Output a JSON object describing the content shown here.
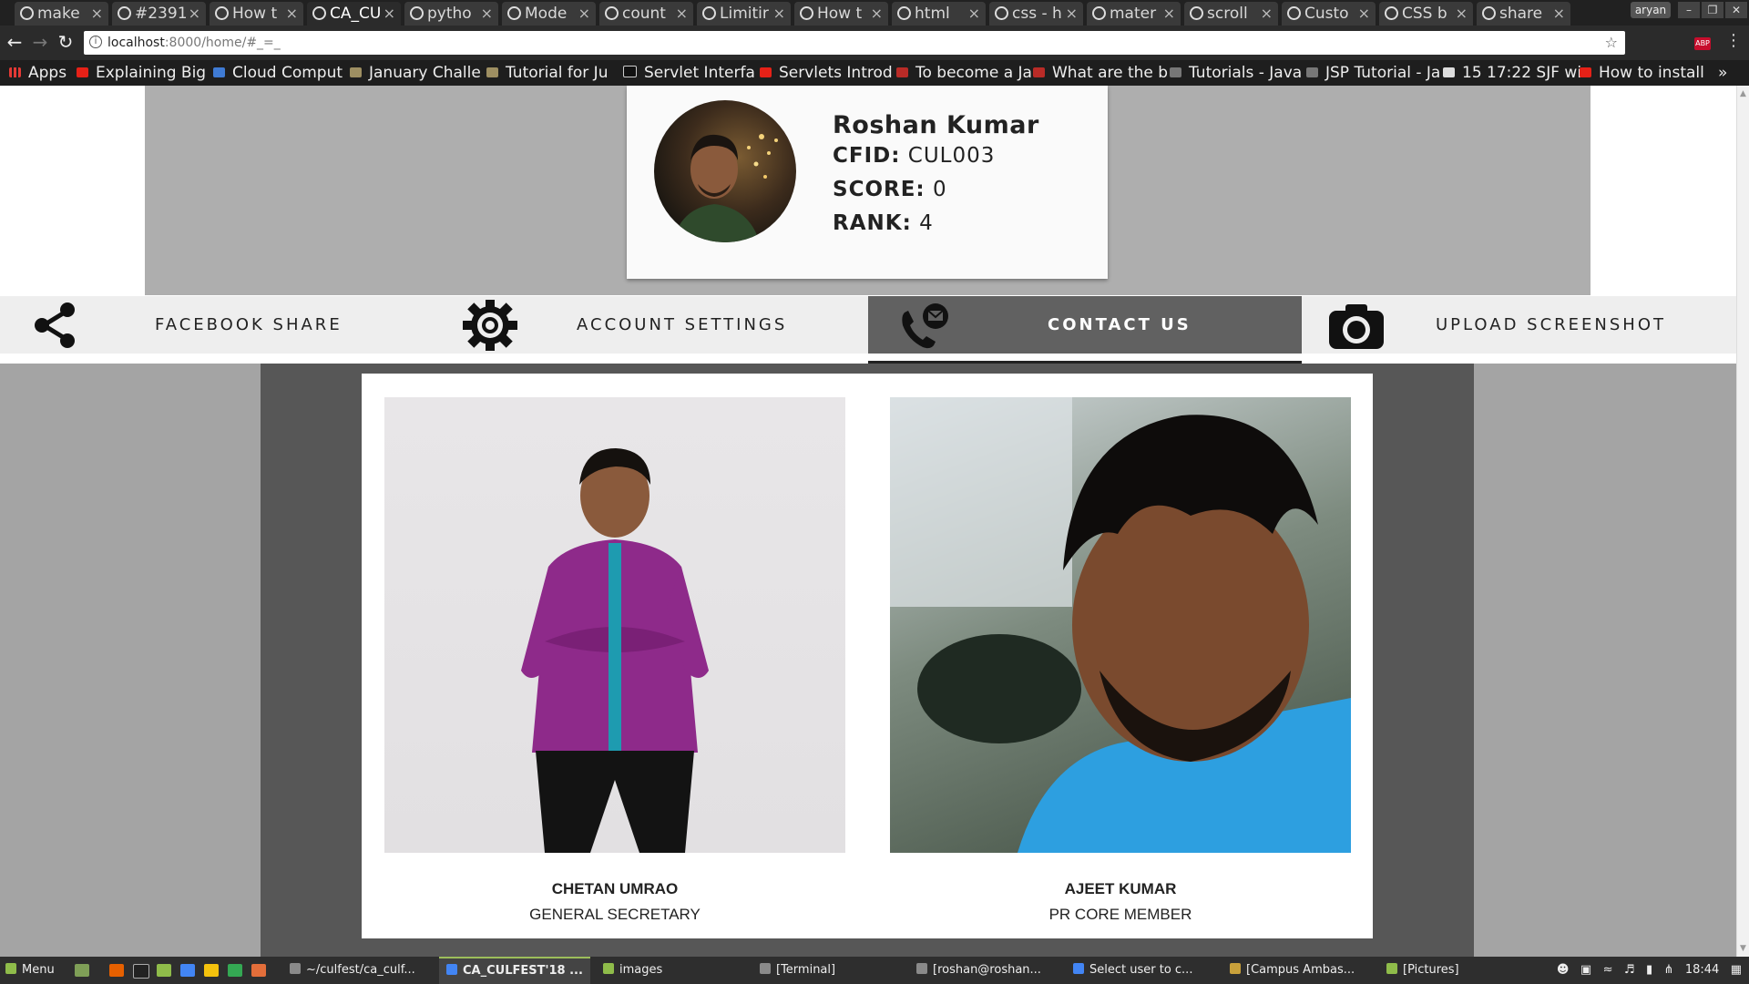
{
  "browser": {
    "tabs": [
      {
        "label": "make",
        "active": false
      },
      {
        "label": "#2391",
        "active": false
      },
      {
        "label": "How t",
        "active": false
      },
      {
        "label": "CA_CU",
        "active": true
      },
      {
        "label": "pytho",
        "active": false
      },
      {
        "label": "Mode",
        "active": false
      },
      {
        "label": "count",
        "active": false
      },
      {
        "label": "Limitir",
        "active": false
      },
      {
        "label": "How t",
        "active": false
      },
      {
        "label": "html",
        "active": false
      },
      {
        "label": "css - h",
        "active": false
      },
      {
        "label": "mater",
        "active": false
      },
      {
        "label": "scroll",
        "active": false
      },
      {
        "label": "Custo",
        "active": false
      },
      {
        "label": "CSS b",
        "active": false
      },
      {
        "label": "share",
        "active": false
      }
    ],
    "tab_close": "×",
    "user": "aryan",
    "url_host": "localhost",
    "url_rest": ":8000/home/#_=_",
    "bookmarks": [
      {
        "label": "Apps",
        "color": "#e53935"
      },
      {
        "label": "Explaining Big",
        "color": "#e62117"
      },
      {
        "label": "Cloud Comput",
        "color": "#3f7bd4"
      },
      {
        "label": "January Challe",
        "color": "#9e8f62"
      },
      {
        "label": "Tutorial for Ju",
        "color": "#9e8f62"
      },
      {
        "label": "Servlet Interfa",
        "color": "#111111"
      },
      {
        "label": "Servlets Introd",
        "color": "#e62117"
      },
      {
        "label": "To become a Ja",
        "color": "#b92b27"
      },
      {
        "label": "What are the b",
        "color": "#b92b27"
      },
      {
        "label": "Tutorials - Java",
        "color": "#777777"
      },
      {
        "label": "JSP Tutorial - Ja",
        "color": "#777777"
      },
      {
        "label": "15 17:22 SJF wi",
        "color": "#dddddd"
      },
      {
        "label": "How to install",
        "color": "#e62117"
      }
    ],
    "bookmarks_overflow": "»"
  },
  "profile": {
    "name": "Roshan Kumar",
    "cfid_label": "CFID:",
    "cfid_value": "CUL003",
    "score_label": "SCORE:",
    "score_value": "0",
    "rank_label": "RANK:",
    "rank_value": "4"
  },
  "menu": {
    "items": [
      {
        "label": "FACEBOOK SHARE",
        "icon": "share-icon",
        "active": false
      },
      {
        "label": "ACCOUNT SETTINGS",
        "icon": "gear-icon",
        "active": false
      },
      {
        "label": "CONTACT US",
        "icon": "phone-mail-icon",
        "active": true
      },
      {
        "label": "UPLOAD SCREENSHOT",
        "icon": "camera-icon",
        "active": false
      }
    ]
  },
  "contacts": [
    {
      "name": "CHETAN UMRAO",
      "role": "GENERAL SECRETARY"
    },
    {
      "name": "AJEET KUMAR",
      "role": "PR CORE MEMBER"
    }
  ],
  "taskbar": {
    "menu_label": "Menu",
    "windows": [
      {
        "label": "~/culfest/ca_culf...",
        "active": false
      },
      {
        "label": "CA_CULFEST'18 ...",
        "active": true
      },
      {
        "label": "images",
        "active": false
      },
      {
        "label": "[Terminal]",
        "active": false
      },
      {
        "label": "[roshan@roshan...",
        "active": false
      },
      {
        "label": "Select user to c...",
        "active": false
      },
      {
        "label": "[Campus Ambas...",
        "active": false
      },
      {
        "label": "[Pictures]",
        "active": false
      }
    ],
    "clock": "18:44"
  },
  "colors": {
    "accent_taskbar": "#9cbe5a",
    "active_menu_bg": "#616161"
  }
}
